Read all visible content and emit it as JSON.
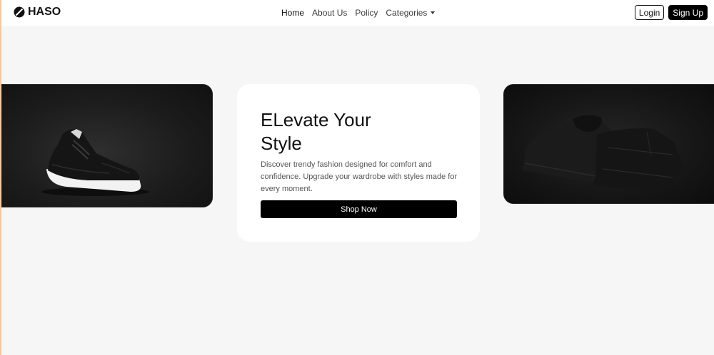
{
  "navbar": {
    "brand": "HASO",
    "links": [
      {
        "label": "Home"
      },
      {
        "label": "About Us"
      },
      {
        "label": "Policy"
      },
      {
        "label": "Categories"
      }
    ],
    "login_label": "Login",
    "signup_label": "Sign Up"
  },
  "hero": {
    "title_line1": "ELevate Your",
    "title_line2": "Style",
    "description": "Discover trendy fashion designed for comfort and confidence. Upgrade your wardrobe with styles made for every moment.",
    "cta_label": "Shop Now"
  },
  "colors": {
    "background": "#f6f6f6",
    "accent": "#000000",
    "card": "#ffffff"
  }
}
